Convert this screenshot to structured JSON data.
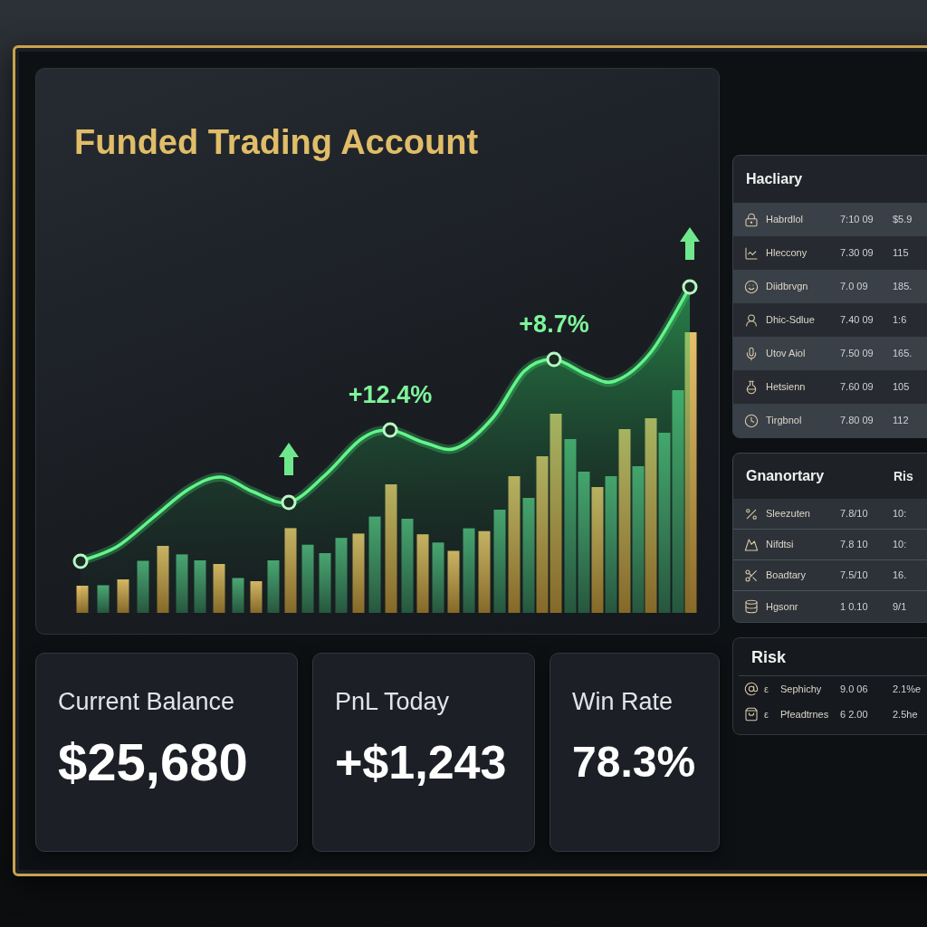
{
  "dashboard": {
    "title": "Funded Trading Account"
  },
  "chart": {
    "annotations": [
      {
        "label": "+12.4%"
      },
      {
        "label": "+8.7%"
      }
    ]
  },
  "stats": [
    {
      "label": "Current Balance",
      "value": "$25,680"
    },
    {
      "label": "PnL Today",
      "value": "+$1,243"
    },
    {
      "label": "Win Rate",
      "value": "78.3%"
    }
  ],
  "side_panels": [
    {
      "kind": "striped",
      "title": "Hacliary",
      "rows": [
        {
          "name": "Habrdlol",
          "value": "7:10 09",
          "column_3": "$5.9"
        },
        {
          "name": "Hleccony",
          "value": "7.30 09",
          "column_3": "115"
        },
        {
          "name": "Diidbrvgn",
          "value": "7.0 09",
          "column_3": "185."
        },
        {
          "name": "Dhic-Sdlue",
          "value": "7.40 09",
          "column_3": "1:6"
        },
        {
          "name": "Utov Aiol",
          "value": "7.50 09",
          "column_3": "165."
        },
        {
          "name": "Hetsienn",
          "value": "7.60 09",
          "column_3": "105"
        },
        {
          "name": "Tirgbnol",
          "value": "7.80 09",
          "column_3": "112"
        }
      ]
    },
    {
      "kind": "ruled",
      "title": "Gnanortary",
      "header_right": "Ris",
      "rows": [
        {
          "name": "Sleezuten",
          "value": "7.8/10",
          "column_3": "10:"
        },
        {
          "name": "Nifdtsi",
          "value": "7.8 10",
          "column_3": "10:"
        },
        {
          "name": "Boadtary",
          "value": "7.5/10",
          "column_3": "16."
        },
        {
          "name": "Hgsonr",
          "value": "1 0.10",
          "column_3": "9/1"
        }
      ]
    },
    {
      "kind": "compact",
      "title": "Risk",
      "rows": [
        {
          "marker": "ε",
          "name": "Sephichy",
          "value": "9.0 06",
          "column_3": "2.1%e"
        },
        {
          "marker": "ε",
          "name": "Pfeadtrnes",
          "value": "6 2.00",
          "column_3": "2.5he"
        }
      ]
    }
  ]
}
